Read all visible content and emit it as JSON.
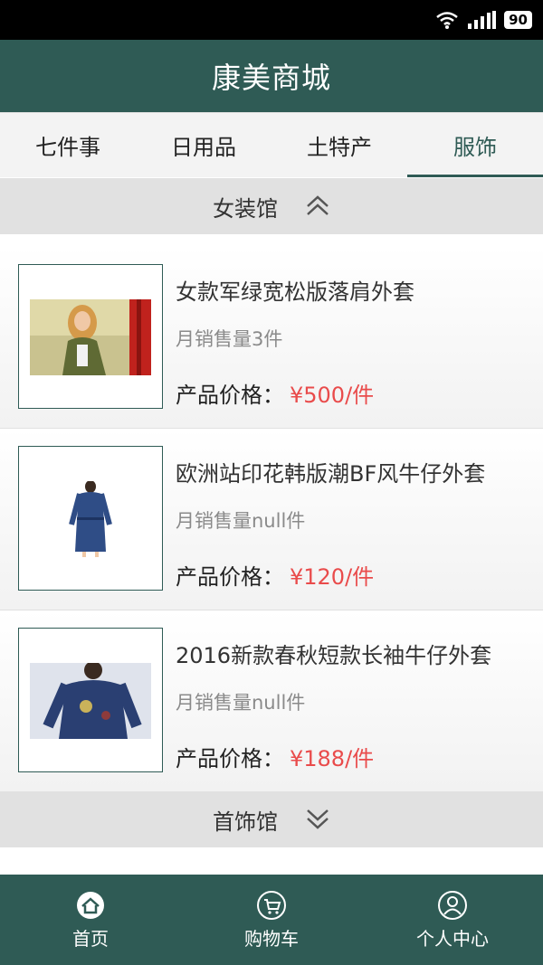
{
  "status_bar": {
    "battery": "90",
    "icons": [
      "wifi-icon",
      "signal-icon",
      "battery-icon"
    ]
  },
  "header": {
    "title": "康美商城"
  },
  "tabs": [
    {
      "label": "七件事",
      "active": false
    },
    {
      "label": "日用品",
      "active": false
    },
    {
      "label": "土特产",
      "active": false
    },
    {
      "label": "服饰",
      "active": true
    }
  ],
  "sections": [
    {
      "label": "女装馆",
      "icon": "chevron-up-icon",
      "expanded": true
    },
    {
      "label": "首饰馆",
      "icon": "chevron-down-icon",
      "expanded": false
    }
  ],
  "price_label": "产品价格：",
  "products": [
    {
      "name": "女款军绿宽松版落肩外套",
      "sales": "月销售量3件",
      "price": "¥500/件"
    },
    {
      "name": "欧洲站印花韩版潮BF风牛仔外套",
      "sales": "月销售量null件",
      "price": "¥120/件"
    },
    {
      "name": "2016新款春秋短款长袖牛仔外套",
      "sales": "月销售量null件",
      "price": "¥188/件"
    }
  ],
  "bottom_nav": [
    {
      "label": "首页",
      "icon": "home-icon"
    },
    {
      "label": "购物车",
      "icon": "cart-icon"
    },
    {
      "label": "个人中心",
      "icon": "user-icon"
    }
  ],
  "colors": {
    "primary": "#2f5b55",
    "price": "#e94b4b",
    "section_bg": "#e1e1e1"
  }
}
